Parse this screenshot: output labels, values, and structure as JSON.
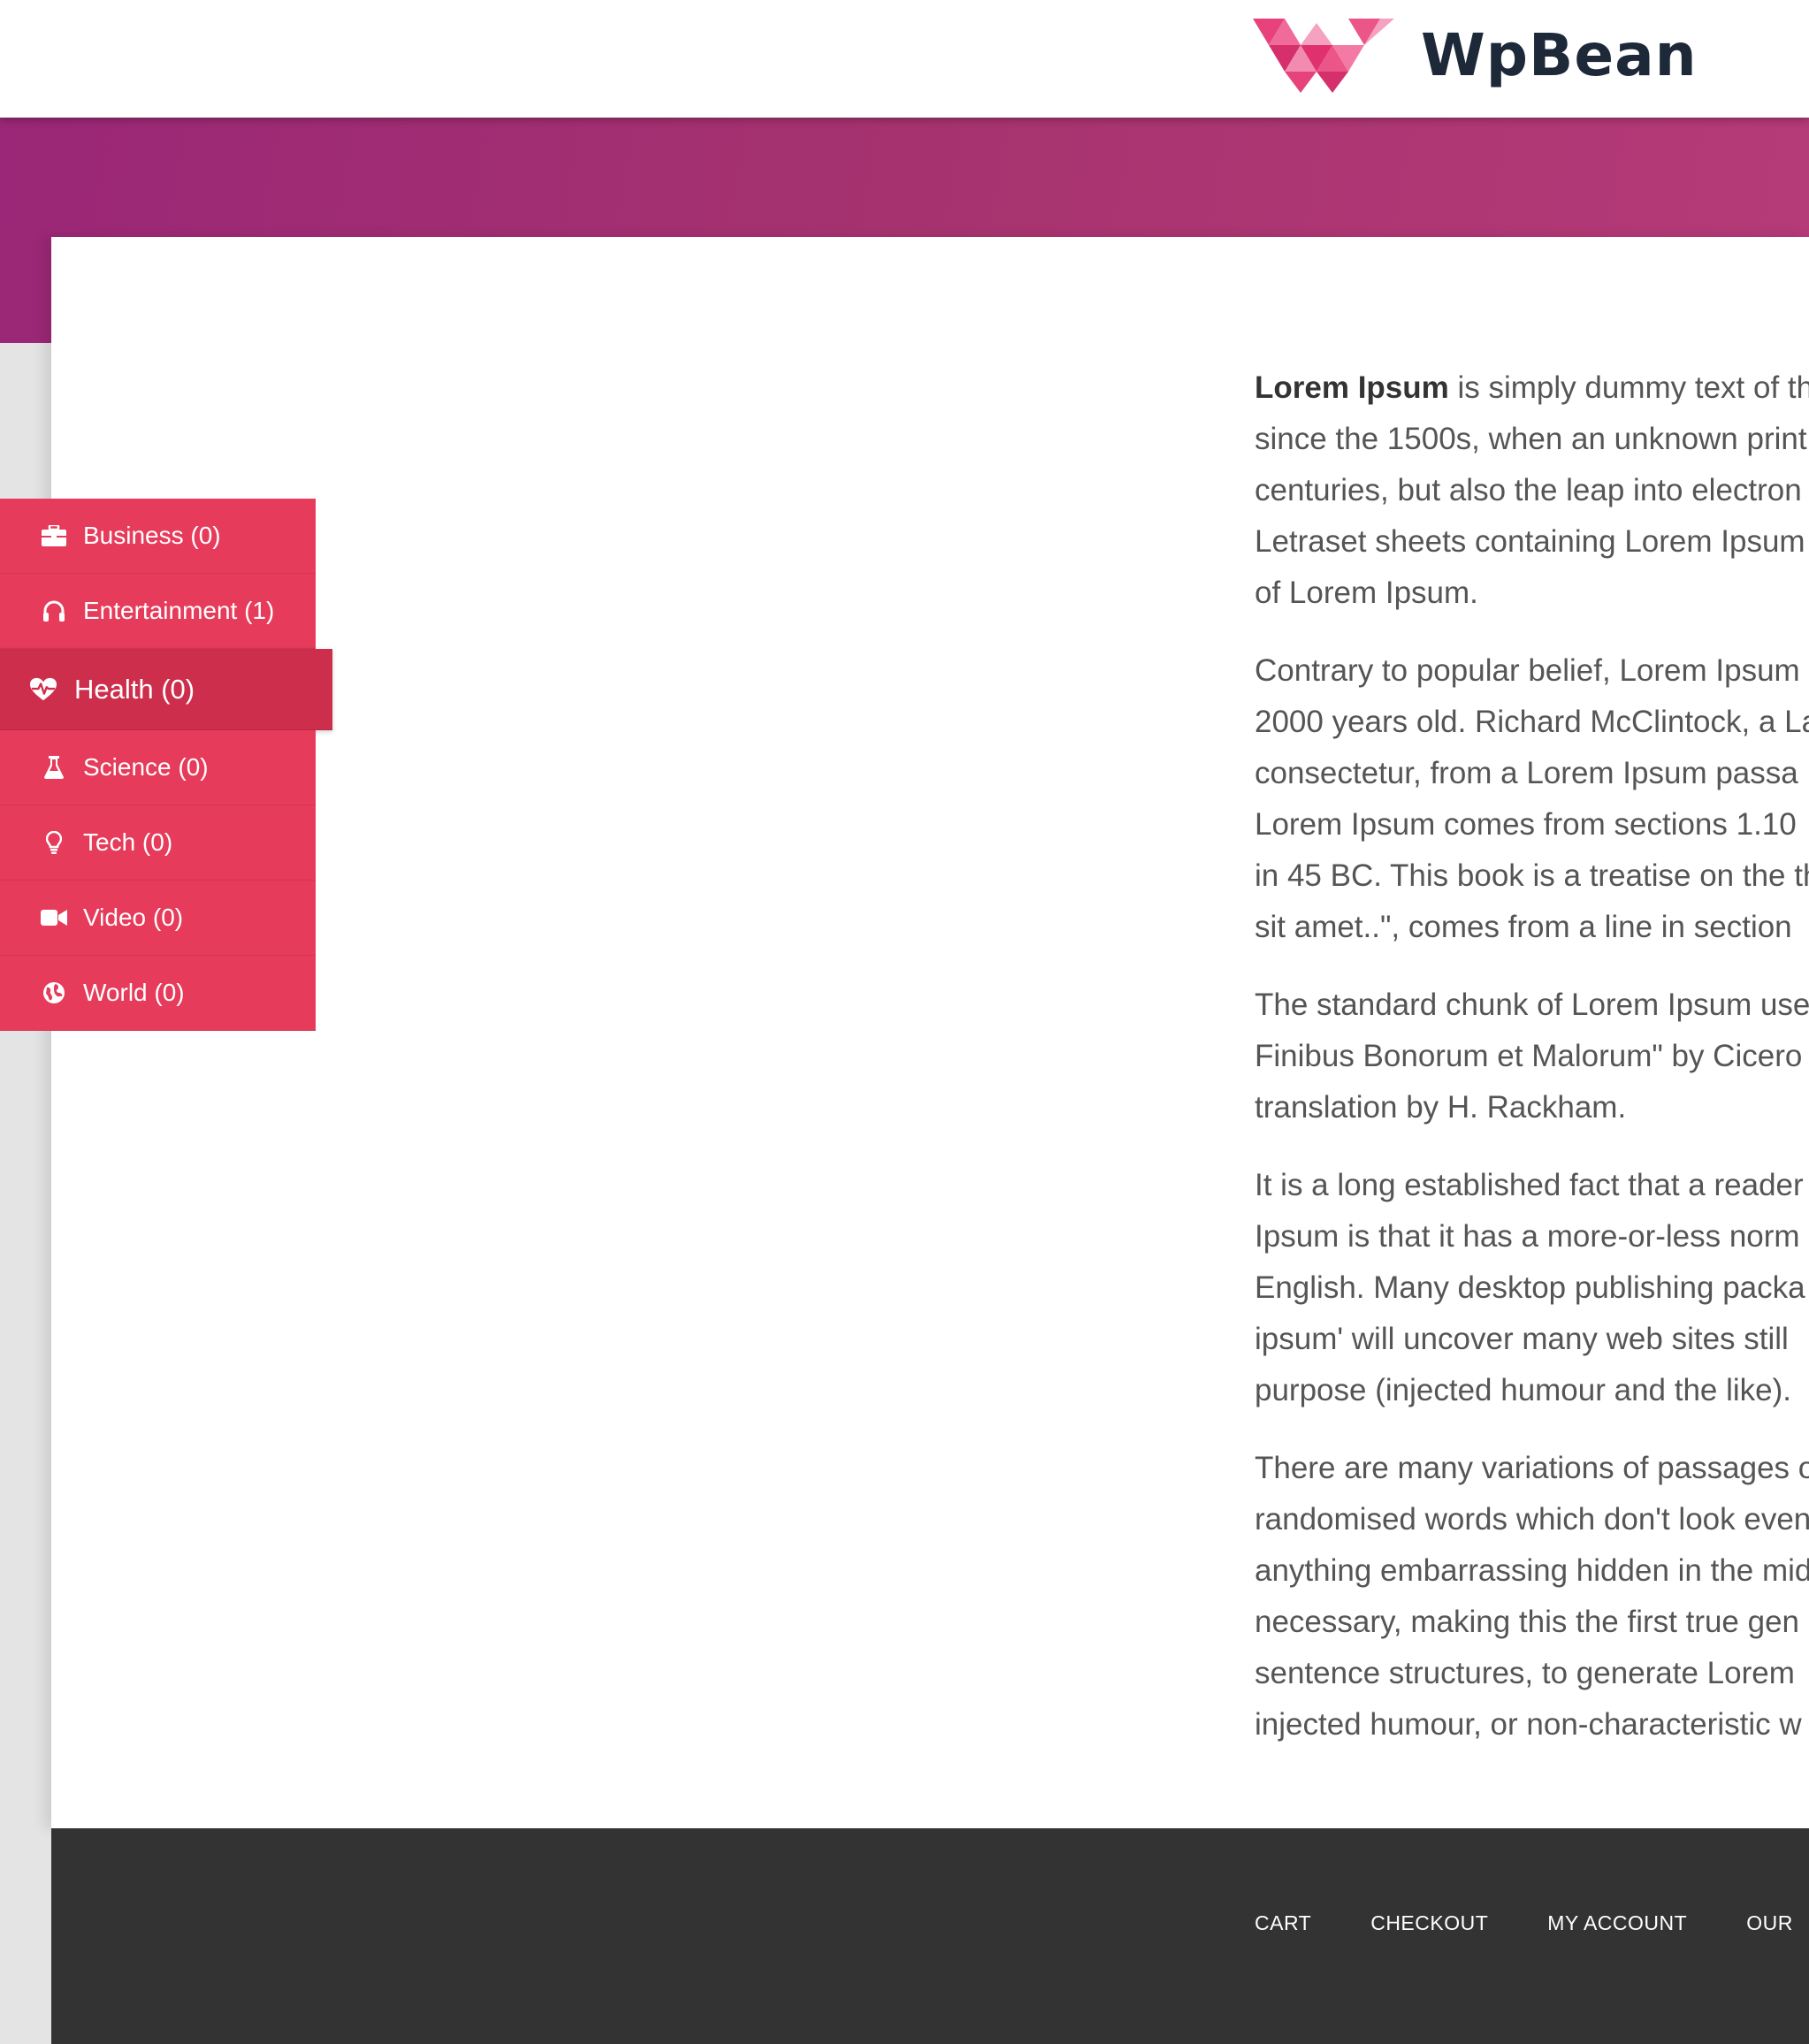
{
  "header": {
    "logo_icon": "wpbean-w-logo-icon",
    "logo_text": "WpBean"
  },
  "colors": {
    "accent": "#e63b5a",
    "accent_active": "#cd2e4b",
    "hero_gradient_start": "#9a2777",
    "hero_gradient_end": "#b53a78",
    "footer": "#333333",
    "logo_pink": "#e8427c"
  },
  "sidebar": {
    "items": [
      {
        "label": "Business (0)",
        "icon": "briefcase-icon"
      },
      {
        "label": "Entertainment (1)",
        "icon": "headphones-icon"
      },
      {
        "label": "Health (0)",
        "icon": "heartbeat-icon",
        "active": true
      },
      {
        "label": "Science (0)",
        "icon": "flask-icon"
      },
      {
        "label": "Tech (0)",
        "icon": "lightbulb-icon"
      },
      {
        "label": "Video (0)",
        "icon": "video-camera-icon"
      },
      {
        "label": "World (0)",
        "icon": "globe-icon"
      }
    ]
  },
  "content": {
    "p1_bold": "Lorem Ipsum",
    "p1_lines": [
      " is simply dummy text of th",
      "since the 1500s, when an unknown print",
      "centuries, but also the leap into electron",
      "Letraset sheets containing Lorem Ipsum",
      "of Lorem Ipsum."
    ],
    "p2_lines": [
      "Contrary to popular belief, Lorem Ipsum",
      "2000 years old. Richard McClintock, a La",
      "consectetur, from a Lorem Ipsum passa",
      "Lorem Ipsum comes from sections 1.10",
      "in 45 BC. This book is a treatise on the th",
      "sit amet..\", comes from a line in section"
    ],
    "p3_lines": [
      "The standard chunk of Lorem Ipsum use",
      "Finibus Bonorum et Malorum\" by Cicero",
      "translation by H. Rackham."
    ],
    "p4_lines": [
      "It is a long established fact that a reader",
      "Ipsum is that it has a more-or-less norm",
      "English. Many desktop publishing packa",
      "ipsum' will uncover many web sites still",
      "purpose (injected humour and the like)."
    ],
    "p5_lines": [
      "There are many variations of passages o",
      "randomised words which don't look even",
      "anything embarrassing hidden in the mid",
      "necessary, making this the first true gen",
      "sentence structures, to generate Lorem",
      "injected humour, or non-characteristic w"
    ]
  },
  "footer": {
    "nav": [
      "CART",
      "CHECKOUT",
      "MY ACCOUNT",
      "OUR"
    ]
  }
}
